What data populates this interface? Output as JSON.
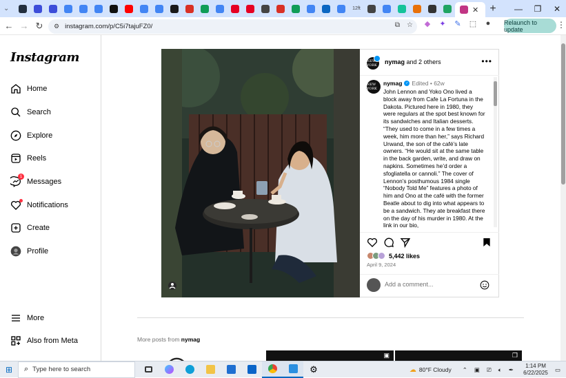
{
  "browser": {
    "tabs": [
      {
        "icon": "chevron-down-icon",
        "color": "#5f6368"
      },
      {
        "icon": "amazon-icon",
        "color": "#232f3e"
      },
      {
        "icon": "dl-icon",
        "color": "#3c4dd9"
      },
      {
        "icon": "dl-icon",
        "color": "#3c4dd9"
      },
      {
        "icon": "google-icon",
        "color": "#4285f4"
      },
      {
        "icon": "docs-icon",
        "color": "#4285f4"
      },
      {
        "icon": "google-icon",
        "color": "#4285f4"
      },
      {
        "icon": "x-icon",
        "color": "#111111"
      },
      {
        "icon": "youtube-icon",
        "color": "#ff0000"
      },
      {
        "icon": "google-icon",
        "color": "#4285f4"
      },
      {
        "icon": "google-icon",
        "color": "#4285f4"
      },
      {
        "icon": "grid-icon",
        "color": "#1a1a1a"
      },
      {
        "icon": "gmail-icon",
        "color": "#d93025"
      },
      {
        "icon": "drive-icon",
        "color": "#0f9d58"
      },
      {
        "icon": "docs-icon",
        "color": "#4285f4"
      },
      {
        "icon": "pinterest-icon",
        "color": "#e60023"
      },
      {
        "icon": "pinterest-icon",
        "color": "#e60023"
      },
      {
        "icon": "compass-icon",
        "color": "#444444"
      },
      {
        "icon": "gmail-icon",
        "color": "#d93025"
      },
      {
        "icon": "sheets-icon",
        "color": "#0f9d58"
      },
      {
        "icon": "google-icon",
        "color": "#4285f4"
      },
      {
        "icon": "linkedin-icon",
        "color": "#0a66c2"
      },
      {
        "icon": "google-icon",
        "color": "#4285f4"
      },
      {
        "icon": "12ft-icon",
        "color": "#444444",
        "label": "12ft"
      },
      {
        "icon": "compass-icon",
        "color": "#444444"
      },
      {
        "icon": "google-icon",
        "color": "#4285f4"
      },
      {
        "icon": "grammarly-icon",
        "color": "#15c39a"
      },
      {
        "icon": "shield-icon",
        "color": "#e8710a"
      },
      {
        "icon": "mail-icon",
        "color": "#333333"
      },
      {
        "icon": "circle-icon",
        "color": "#1fa463"
      },
      {
        "icon": "instagram-icon",
        "color": "#c13584"
      }
    ],
    "url": "instagram.com/p/C5i7tajuFZ0/",
    "relaunch_label": "Relaunch to update"
  },
  "sidebar": {
    "logo": "Instagram",
    "items": [
      {
        "label": "Home",
        "icon": "home-icon"
      },
      {
        "label": "Search",
        "icon": "search-icon"
      },
      {
        "label": "Explore",
        "icon": "compass-icon"
      },
      {
        "label": "Reels",
        "icon": "reels-icon"
      },
      {
        "label": "Messages",
        "icon": "messenger-icon",
        "badge": "1"
      },
      {
        "label": "Notifications",
        "icon": "heart-icon"
      },
      {
        "label": "Create",
        "icon": "plus-square-icon"
      },
      {
        "label": "Profile",
        "icon": "profile-avatar-icon"
      },
      {
        "label": "More",
        "icon": "menu-icon"
      },
      {
        "label": "Also from Meta",
        "icon": "meta-icon"
      }
    ]
  },
  "post": {
    "header_user": "nymag",
    "header_suffix": "and 2 others",
    "caption_user": "nymag",
    "caption_meta": "Edited • 62w",
    "caption": "John Lennon and Yoko Ono lived a block away from Cafe La Fortuna in the Dakota. Pictured here in 1980, they were regulars at the spot best known for its sandwiches and Italian desserts. “They used to come in a few times a week, him more than her,” says Richard Urwand, the son of the café’s late owners. “He would sit at the same table in the back garden, write, and draw on napkins. Sometimes he’d order a sfogliatella or cannoli.” The cover of Lennon’s posthumous 1984 single “Nobody Told Me” features a photo of him and Ono at the café with the former Beatle about to dig into what appears to be a sandwich. They ate breakfast there on the day of his murder in 1980. At the link in our bio,",
    "likes": "5,442 likes",
    "date": "April 9, 2024",
    "comment_placeholder": "Add a comment...",
    "avatar_text": "NEW YORK"
  },
  "more_posts": {
    "prefix": "More posts from",
    "user": "nymag"
  },
  "taskbar": {
    "search_placeholder": "Type here to search",
    "weather": "80°F  Cloudy",
    "time": "1:14 PM",
    "date": "6/22/2025"
  }
}
